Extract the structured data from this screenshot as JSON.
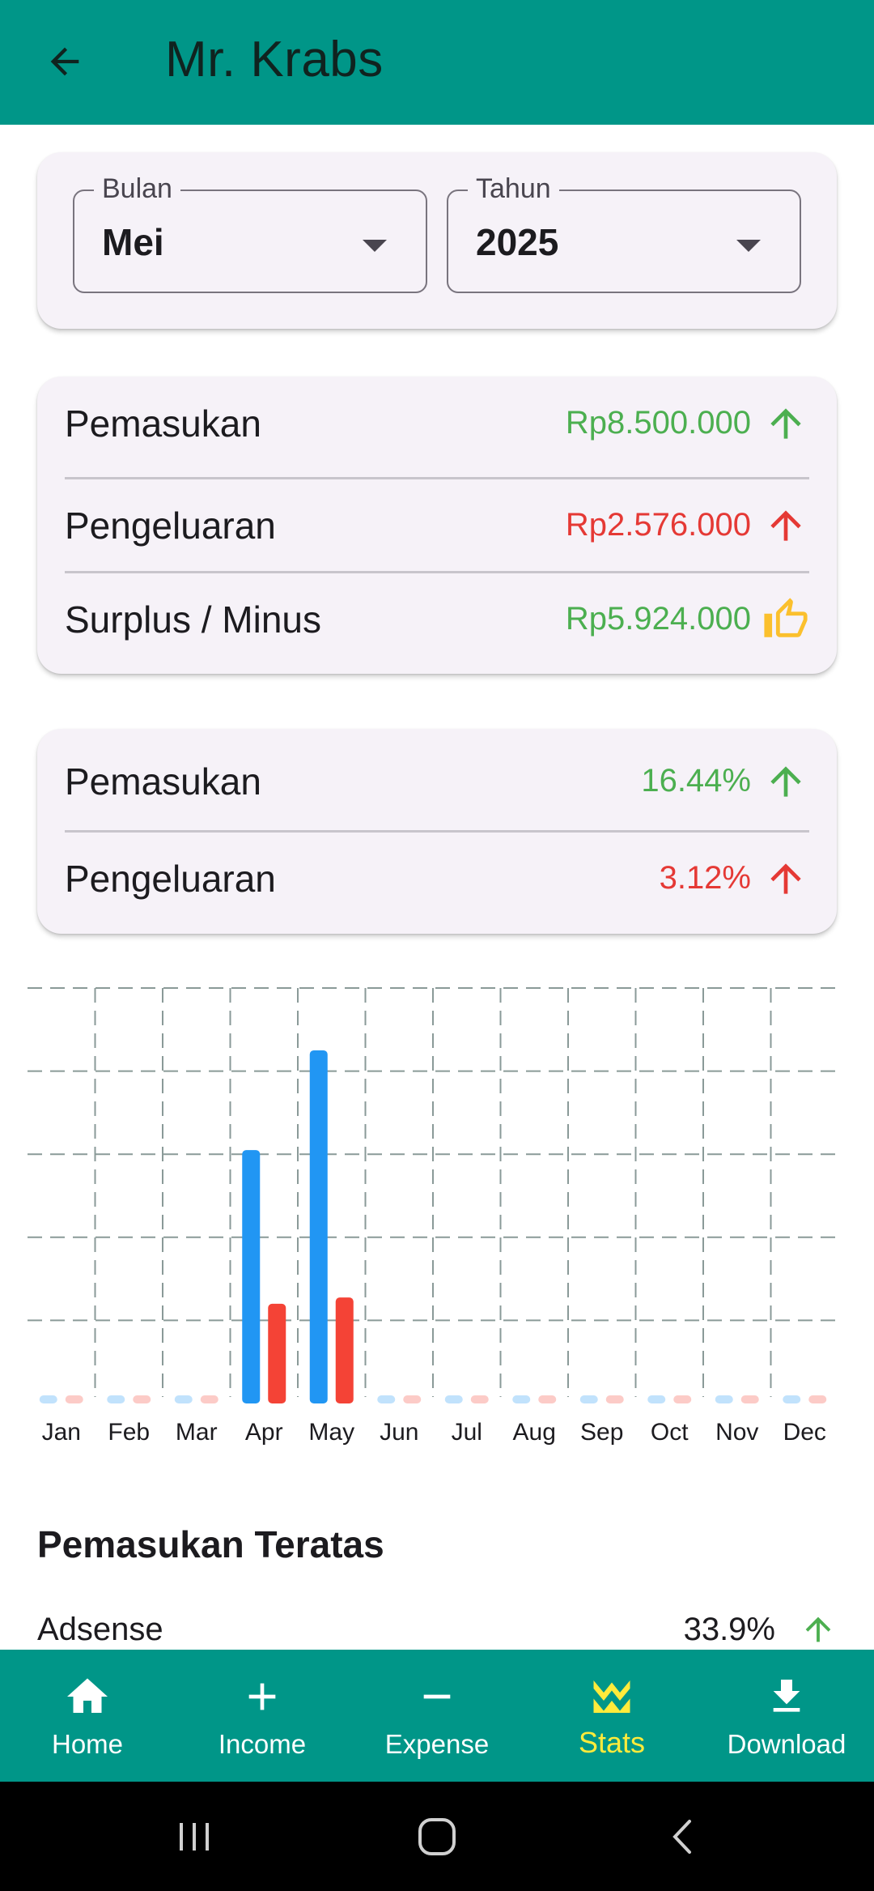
{
  "app_bar": {
    "title": "Mr. Krabs"
  },
  "filter": {
    "month": {
      "label": "Bulan",
      "value": "Mei"
    },
    "year": {
      "label": "Tahun",
      "value": "2025"
    }
  },
  "summary": {
    "income": {
      "label": "Pemasukan",
      "value": "Rp8.500.000"
    },
    "expense": {
      "label": "Pengeluaran",
      "value": "Rp2.576.000"
    },
    "surplus": {
      "label": "Surplus / Minus",
      "value": "Rp5.924.000"
    }
  },
  "percent": {
    "income": {
      "label": "Pemasukan",
      "value": "16.44%"
    },
    "expense": {
      "label": "Pengeluaran",
      "value": "3.12%"
    }
  },
  "colors": {
    "primary": "#009688",
    "income": "#4caf50",
    "expense": "#e53935",
    "bar_income": "#2196f3",
    "bar_expense": "#f44336",
    "active_nav": "#ffeb3b",
    "thumb": "#fbc02d"
  },
  "chart_data": {
    "type": "bar",
    "categories": [
      "Jan",
      "Feb",
      "Mar",
      "Apr",
      "May",
      "Jun",
      "Jul",
      "Aug",
      "Sep",
      "Oct",
      "Nov",
      "Dec"
    ],
    "series": [
      {
        "values": [
          0,
          0,
          0,
          0.61,
          0.85,
          0,
          0,
          0,
          0,
          0,
          0,
          0
        ]
      },
      {
        "values": [
          0,
          0,
          0,
          0.24,
          0.255,
          0,
          0,
          0,
          0,
          0,
          0,
          0
        ]
      }
    ],
    "ylim": [
      0,
      1
    ],
    "grid": true,
    "grid_style": "dashed",
    "title": "",
    "xlabel": "",
    "ylabel": ""
  },
  "top_income": {
    "title": "Pemasukan Teratas",
    "items": [
      {
        "label": "Adsense",
        "value": "33.9%"
      }
    ]
  },
  "bottom_nav": [
    {
      "label": "Home",
      "icon": "home-icon"
    },
    {
      "label": "Income",
      "icon": "plus-icon"
    },
    {
      "label": "Expense",
      "icon": "minus-icon"
    },
    {
      "label": "Stats",
      "icon": "stats-icon",
      "active": true
    },
    {
      "label": "Download",
      "icon": "download-icon"
    }
  ]
}
